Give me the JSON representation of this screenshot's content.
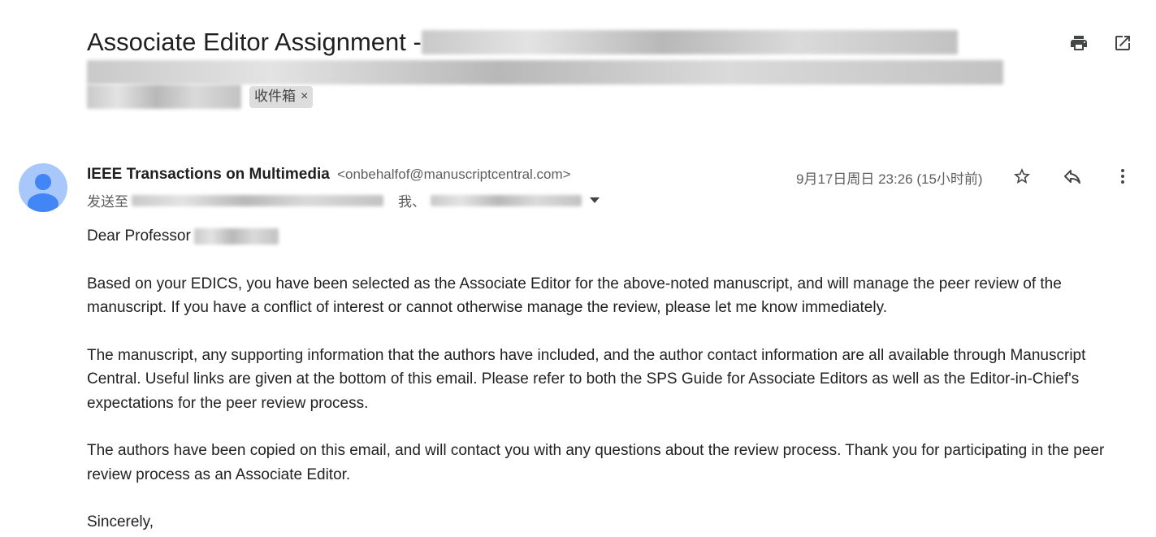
{
  "subject": {
    "prefix": "Associate Editor Assignment - ",
    "label_chip": "收件箱",
    "chip_close": "×"
  },
  "toolbar": {
    "print_icon": "print-icon",
    "popout_icon": "open-in-new-window-icon"
  },
  "sender": {
    "name": "IEEE Transactions on Multimedia",
    "email": "<onbehalfof@manuscriptcentral.com>",
    "to_prefix": "发送至",
    "to_me": "我、",
    "date": "9月17日周日 23:26 (15小时前)"
  },
  "actions": {
    "star_icon": "star-icon",
    "reply_icon": "reply-icon",
    "more_icon": "more-vert-icon"
  },
  "body": {
    "greeting": "Dear Professor",
    "para1": "Based on your EDICS, you have been selected as the Associate Editor for the above-noted manuscript, and will manage the peer review of the manuscript.  If you have a conflict of interest or cannot otherwise manage the review, please let me know immediately.",
    "para2": "The manuscript, any supporting information that the authors have included, and the author contact information are all available through Manuscript Central.  Useful links are given at the bottom of this email.  Please refer to both the SPS Guide for Associate Editors as well as the Editor-in-Chief's expectations for the peer review process.",
    "para3": "The authors have been copied on this email, and will contact you with any questions about the review process.  Thank you for participating in the peer review process as an Associate Editor.",
    "closing": "Sincerely,"
  },
  "colors": {
    "avatar_bg": "#a8c7fa",
    "avatar_fg": "#4285f4",
    "chip_bg": "#dddddd"
  }
}
